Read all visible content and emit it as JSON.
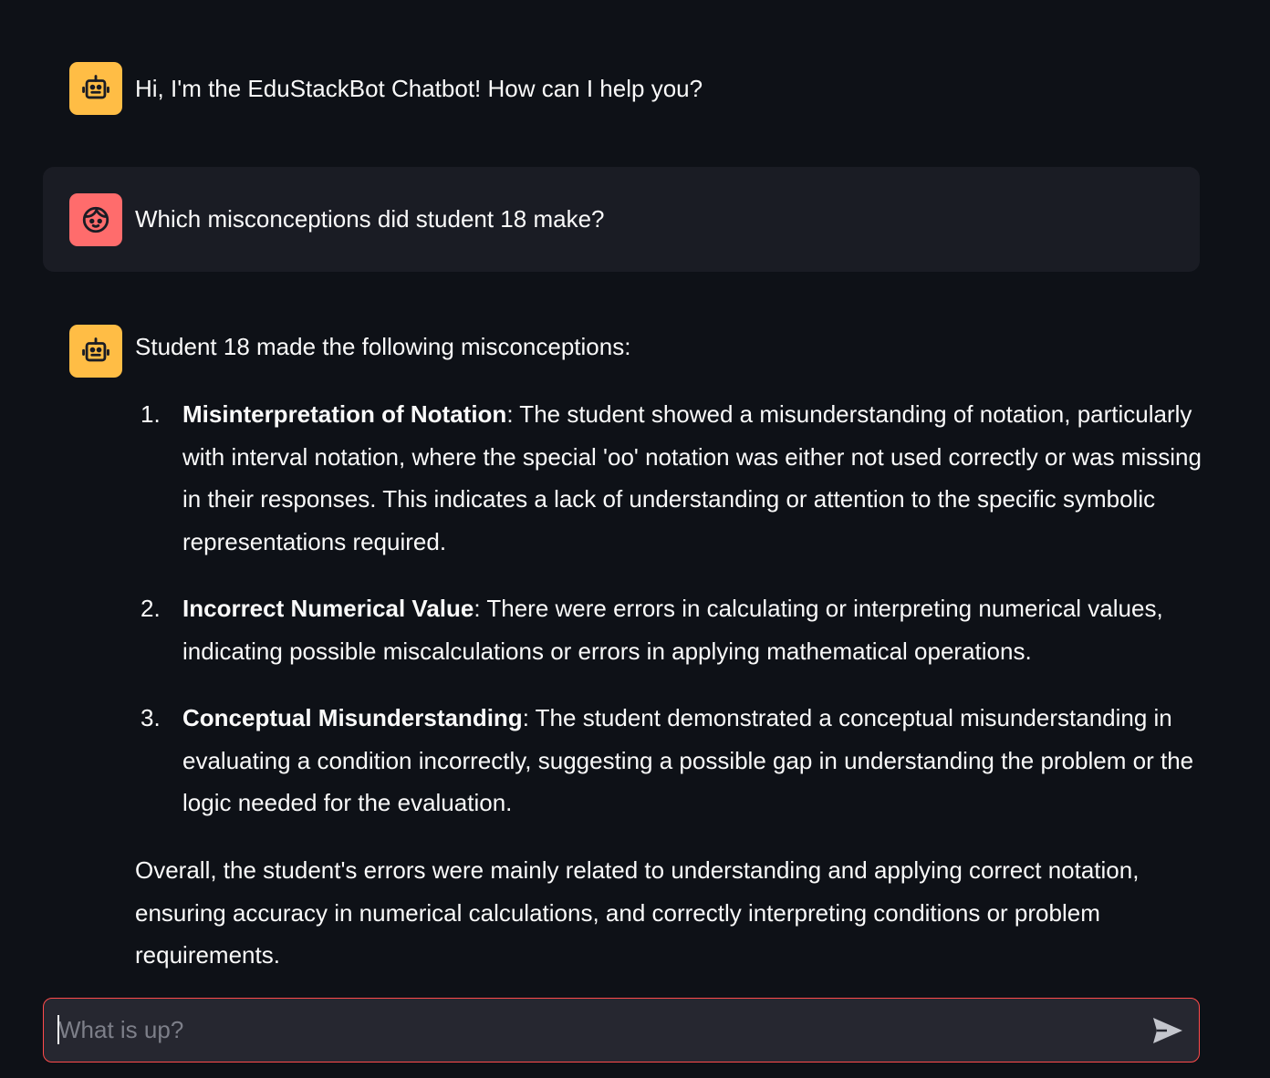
{
  "messages": [
    {
      "role": "assistant",
      "avatar_icon": "robot-icon",
      "text": "Hi, I'm the EduStackBot Chatbot! How can I help you?"
    },
    {
      "role": "user",
      "avatar_icon": "user-face-icon",
      "text": "Which misconceptions did student 18 make?"
    },
    {
      "role": "assistant",
      "avatar_icon": "robot-icon",
      "intro": "Student 18 made the following misconceptions:",
      "items": [
        {
          "number": "1.",
          "title": "Misinterpretation of Notation",
          "body": ": The student showed a misunderstanding of notation, particularly with interval notation, where the special 'oo' notation was either not used correctly or was missing in their responses. This indicates a lack of understanding or attention to the specific symbolic representations required."
        },
        {
          "number": "2.",
          "title": "Incorrect Numerical Value",
          "body": ": There were errors in calculating or interpreting numerical values, indicating possible miscalculations or errors in applying mathematical operations."
        },
        {
          "number": "3.",
          "title": "Conceptual Misunderstanding",
          "body": ": The student demonstrated a conceptual misunderstanding in evaluating a condition incorrectly, suggesting a possible gap in understanding the problem or the logic needed for the evaluation."
        }
      ],
      "summary": "Overall, the student's errors were mainly related to understanding and applying correct notation, ensuring accuracy in numerical calculations, and correctly interpreting conditions or problem requirements."
    }
  ],
  "chat_input": {
    "placeholder": "What is up?",
    "value": "",
    "send_icon": "send-icon"
  },
  "colors": {
    "background": "#0e1117",
    "user_message_bg": "#1a1c24",
    "bot_avatar": "#ffbd45",
    "user_avatar": "#ff6c6c",
    "input_border_focus": "#ff4b4b",
    "input_bg": "#262730"
  }
}
